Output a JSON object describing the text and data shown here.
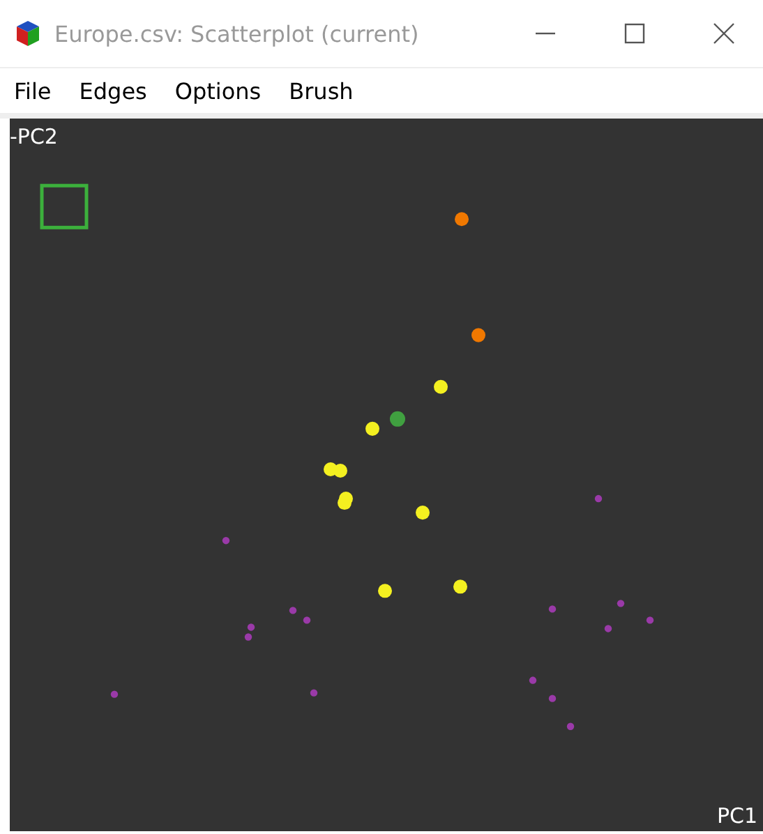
{
  "window": {
    "title": "Europe.csv: Scatterplot (current)"
  },
  "menu": [
    "File",
    "Edges",
    "Options",
    "Brush"
  ],
  "plot": {
    "y_label": "-PC2",
    "x_label": "PC1"
  }
}
